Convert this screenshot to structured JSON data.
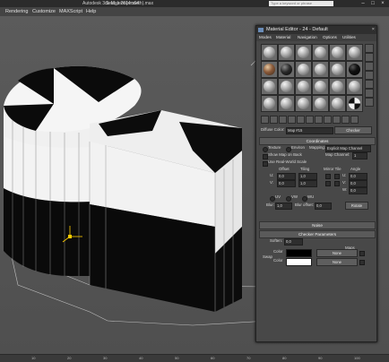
{
  "titlebar": {
    "app_title": "Autodesk 3ds Max  2014 x64",
    "file_name": "Seat_leon(smooth).max",
    "search_placeholder": "Type a keyword or phrase"
  },
  "menubar": {
    "items": [
      "Rendering",
      "Customize",
      "MAXScript",
      "Help"
    ]
  },
  "material_editor": {
    "title": "Material Editor - 24 - Default",
    "menu": [
      "Modes",
      "Material",
      "Navigation",
      "Options",
      "Utilities"
    ],
    "slot_styles": [
      "grey",
      "grey",
      "grey",
      "grey",
      "grey",
      "grey",
      "tex",
      "dark",
      "grey",
      "grey",
      "grey",
      "black",
      "grey",
      "grey",
      "grey",
      "grey",
      "grey",
      "grey",
      "grey",
      "grey",
      "grey",
      "grey",
      "grey",
      "checker"
    ],
    "map_name_label": "Diffuse Color:",
    "map_name": "Map #15",
    "map_type": "Checker",
    "coordinates": {
      "header": "Coordinates",
      "texture_label": "Texture",
      "environ_label": "Environ",
      "mapping_label": "Mapping:",
      "mapping_value": "Explicit Map Channel",
      "show_map_back": "Show Map on Back",
      "map_channel_label": "Map Channel:",
      "map_channel_value": "1",
      "real_world": "Use Real-World Scale",
      "col_offset": "Offset",
      "col_tiling": "Tiling",
      "col_mirror_tile": "Mirror Tile",
      "col_angle": "Angle",
      "row_u": "U:",
      "row_v": "V:",
      "row_w": "W:",
      "u_offset": "0,0",
      "u_tiling": "1,0",
      "u_angle": "0,0",
      "v_offset": "0,0",
      "v_tiling": "1,0",
      "v_angle": "0,0",
      "w_angle": "0,0",
      "uv_label": "UV",
      "vw_label": "VW",
      "wu_label": "WU",
      "blur_label": "Blur:",
      "blur_value": "1,0",
      "blur_offset_label": "Blur offset:",
      "blur_offset_value": "0,0",
      "rotate_label": "Rotate"
    },
    "noise": {
      "header": "Noise"
    },
    "checker_params": {
      "header": "Checker Parameters",
      "softens_label": "Soften:",
      "softens_value": "0,0",
      "maps_label": "Maps",
      "swap_label": "Swap",
      "color1_label": "Color",
      "color1_map": "None",
      "color2_label": "Color",
      "color2_map": "None",
      "color1_hex": "#000000",
      "color2_hex": "#ffffff"
    }
  },
  "timeline": {
    "ticks": [
      "10",
      "20",
      "30",
      "40",
      "50",
      "60",
      "70",
      "80",
      "90",
      "100"
    ]
  },
  "colors": {
    "viewport_bg": "#555555",
    "accent": "#ffcc00"
  }
}
